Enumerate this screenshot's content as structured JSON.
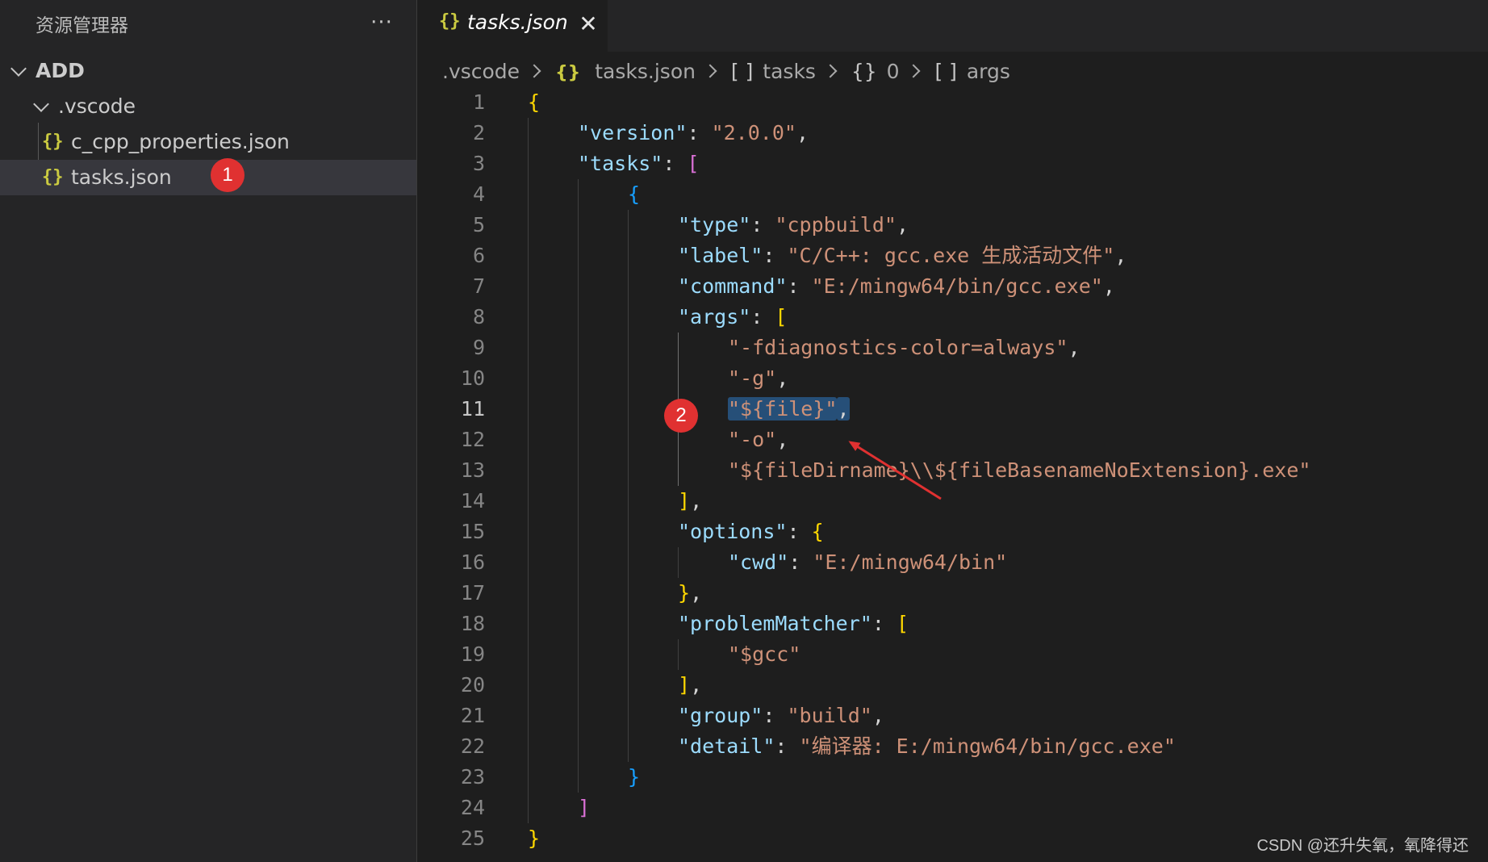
{
  "explorer": {
    "title": "资源管理器",
    "more_label": "···",
    "root_folder": "ADD",
    "folder": ".vscode",
    "files": [
      {
        "name": "c_cpp_properties.json",
        "icon": "{}"
      },
      {
        "name": "tasks.json",
        "icon": "{}"
      }
    ],
    "badge_1": "1"
  },
  "tab": {
    "icon": "{}",
    "label": "tasks.json",
    "close_label": "✕"
  },
  "breadcrumb": {
    "items": [
      ".vscode",
      "tasks.json",
      "tasks",
      "0",
      "args"
    ],
    "icons": [
      "",
      "{}",
      "[ ]",
      "{}",
      "[ ]"
    ]
  },
  "editor": {
    "active_line": 11,
    "line_numbers": [
      "1",
      "2",
      "3",
      "4",
      "5",
      "6",
      "7",
      "8",
      "9",
      "10",
      "11",
      "12",
      "13",
      "14",
      "15",
      "16",
      "17",
      "18",
      "19",
      "20",
      "21",
      "22",
      "23",
      "24",
      "25"
    ],
    "lines": [
      [
        {
          "t": "{",
          "c": "b1"
        }
      ],
      [
        {
          "t": "\"version\"",
          "c": "k"
        },
        {
          "t": ": ",
          "c": "p"
        },
        {
          "t": "\"2.0.0\"",
          "c": "s"
        },
        {
          "t": ",",
          "c": "p"
        }
      ],
      [
        {
          "t": "\"tasks\"",
          "c": "k"
        },
        {
          "t": ": ",
          "c": "p"
        },
        {
          "t": "[",
          "c": "b2"
        }
      ],
      [
        {
          "t": "{",
          "c": "b3"
        }
      ],
      [
        {
          "t": "\"type\"",
          "c": "k"
        },
        {
          "t": ": ",
          "c": "p"
        },
        {
          "t": "\"cppbuild\"",
          "c": "s"
        },
        {
          "t": ",",
          "c": "p"
        }
      ],
      [
        {
          "t": "\"label\"",
          "c": "k"
        },
        {
          "t": ": ",
          "c": "p"
        },
        {
          "t": "\"C/C++: gcc.exe 生成活动文件\"",
          "c": "s"
        },
        {
          "t": ",",
          "c": "p"
        }
      ],
      [
        {
          "t": "\"command\"",
          "c": "k"
        },
        {
          "t": ": ",
          "c": "p"
        },
        {
          "t": "\"E:/mingw64/bin/gcc.exe\"",
          "c": "s"
        },
        {
          "t": ",",
          "c": "p"
        }
      ],
      [
        {
          "t": "\"args\"",
          "c": "k"
        },
        {
          "t": ": ",
          "c": "p"
        },
        {
          "t": "[",
          "c": "b1"
        }
      ],
      [
        {
          "t": "\"-fdiagnostics-color=always\"",
          "c": "s"
        },
        {
          "t": ",",
          "c": "p"
        }
      ],
      [
        {
          "t": "\"-g\"",
          "c": "s"
        },
        {
          "t": ",",
          "c": "p"
        }
      ],
      [
        {
          "t": "\"${file}\"",
          "c": "s sel"
        },
        {
          "t": ",",
          "c": "p sel"
        }
      ],
      [
        {
          "t": "\"-o\"",
          "c": "s"
        },
        {
          "t": ",",
          "c": "p"
        }
      ],
      [
        {
          "t": "\"${fileDirname}\\\\${fileBasenameNoExtension}.exe\"",
          "c": "s"
        }
      ],
      [
        {
          "t": "]",
          "c": "b1"
        },
        {
          "t": ",",
          "c": "p"
        }
      ],
      [
        {
          "t": "\"options\"",
          "c": "k"
        },
        {
          "t": ": ",
          "c": "p"
        },
        {
          "t": "{",
          "c": "b1"
        }
      ],
      [
        {
          "t": "\"cwd\"",
          "c": "k"
        },
        {
          "t": ": ",
          "c": "p"
        },
        {
          "t": "\"E:/mingw64/bin\"",
          "c": "s"
        }
      ],
      [
        {
          "t": "}",
          "c": "b1"
        },
        {
          "t": ",",
          "c": "p"
        }
      ],
      [
        {
          "t": "\"problemMatcher\"",
          "c": "k"
        },
        {
          "t": ": ",
          "c": "p"
        },
        {
          "t": "[",
          "c": "b1"
        }
      ],
      [
        {
          "t": "\"$gcc\"",
          "c": "s"
        }
      ],
      [
        {
          "t": "]",
          "c": "b1"
        },
        {
          "t": ",",
          "c": "p"
        }
      ],
      [
        {
          "t": "\"group\"",
          "c": "k"
        },
        {
          "t": ": ",
          "c": "p"
        },
        {
          "t": "\"build\"",
          "c": "s"
        },
        {
          "t": ",",
          "c": "p"
        }
      ],
      [
        {
          "t": "\"detail\"",
          "c": "k"
        },
        {
          "t": ": ",
          "c": "p"
        },
        {
          "t": "\"编译器: E:/mingw64/bin/gcc.exe\"",
          "c": "s"
        }
      ],
      [
        {
          "t": "}",
          "c": "b3"
        }
      ],
      [
        {
          "t": "]",
          "c": "b2"
        }
      ],
      [
        {
          "t": "}",
          "c": "b1"
        }
      ]
    ],
    "badge_2": "2"
  },
  "watermark": "CSDN @还升失氧，氧降得还",
  "colors": {
    "key": "#9cdcfe",
    "string": "#ce9178",
    "bracket_gold": "#ffd700",
    "bracket_purple": "#da70d6",
    "bracket_blue": "#179fff",
    "selection": "#264f78",
    "badge": "#e03131",
    "arrow": "#e03131",
    "json_icon": "#cbcb41"
  }
}
